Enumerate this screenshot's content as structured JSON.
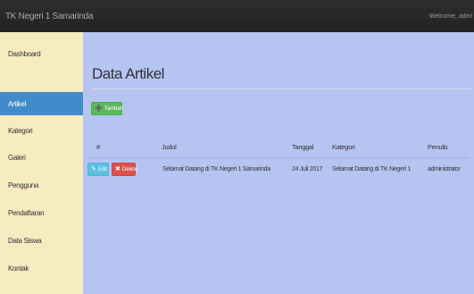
{
  "topbar": {
    "brand": "TK Negeri 1 Samarinda",
    "welcome": "Welcome, admi"
  },
  "sidebar": {
    "items": [
      {
        "label": "Dashboard",
        "active": false
      },
      {
        "label": "Artikel",
        "active": true
      },
      {
        "label": "Kategori",
        "active": false
      },
      {
        "label": "Galeri",
        "active": false
      },
      {
        "label": "Pengguna",
        "active": false
      },
      {
        "label": "Pendaftaran",
        "active": false
      },
      {
        "label": "Data Siswa",
        "active": false
      },
      {
        "label": "Kontak",
        "active": false
      }
    ]
  },
  "main": {
    "title": "Data Artikel",
    "add_button": {
      "label": "Tambah",
      "icon": "plus-circle-icon"
    },
    "table": {
      "columns": [
        "#",
        "Judul",
        "Tanggal",
        "Kategori",
        "Penulis"
      ],
      "rows": [
        {
          "edit_label": "Edit",
          "delete_label": "Delete",
          "judul": "Selamat Datang di TK Negeri 1 Samarinda",
          "tanggal": "24 Juli 2017",
          "kategori": "Selamat Datang di TK Negeri 1",
          "penulis": "administrator"
        }
      ]
    }
  },
  "colors": {
    "topbar": "#222222",
    "sidebar": "#f7ebc1",
    "active": "#428bca",
    "main": "#b6c4f2",
    "success": "#5cb85c",
    "info": "#5bc0de",
    "danger": "#d9534f"
  }
}
